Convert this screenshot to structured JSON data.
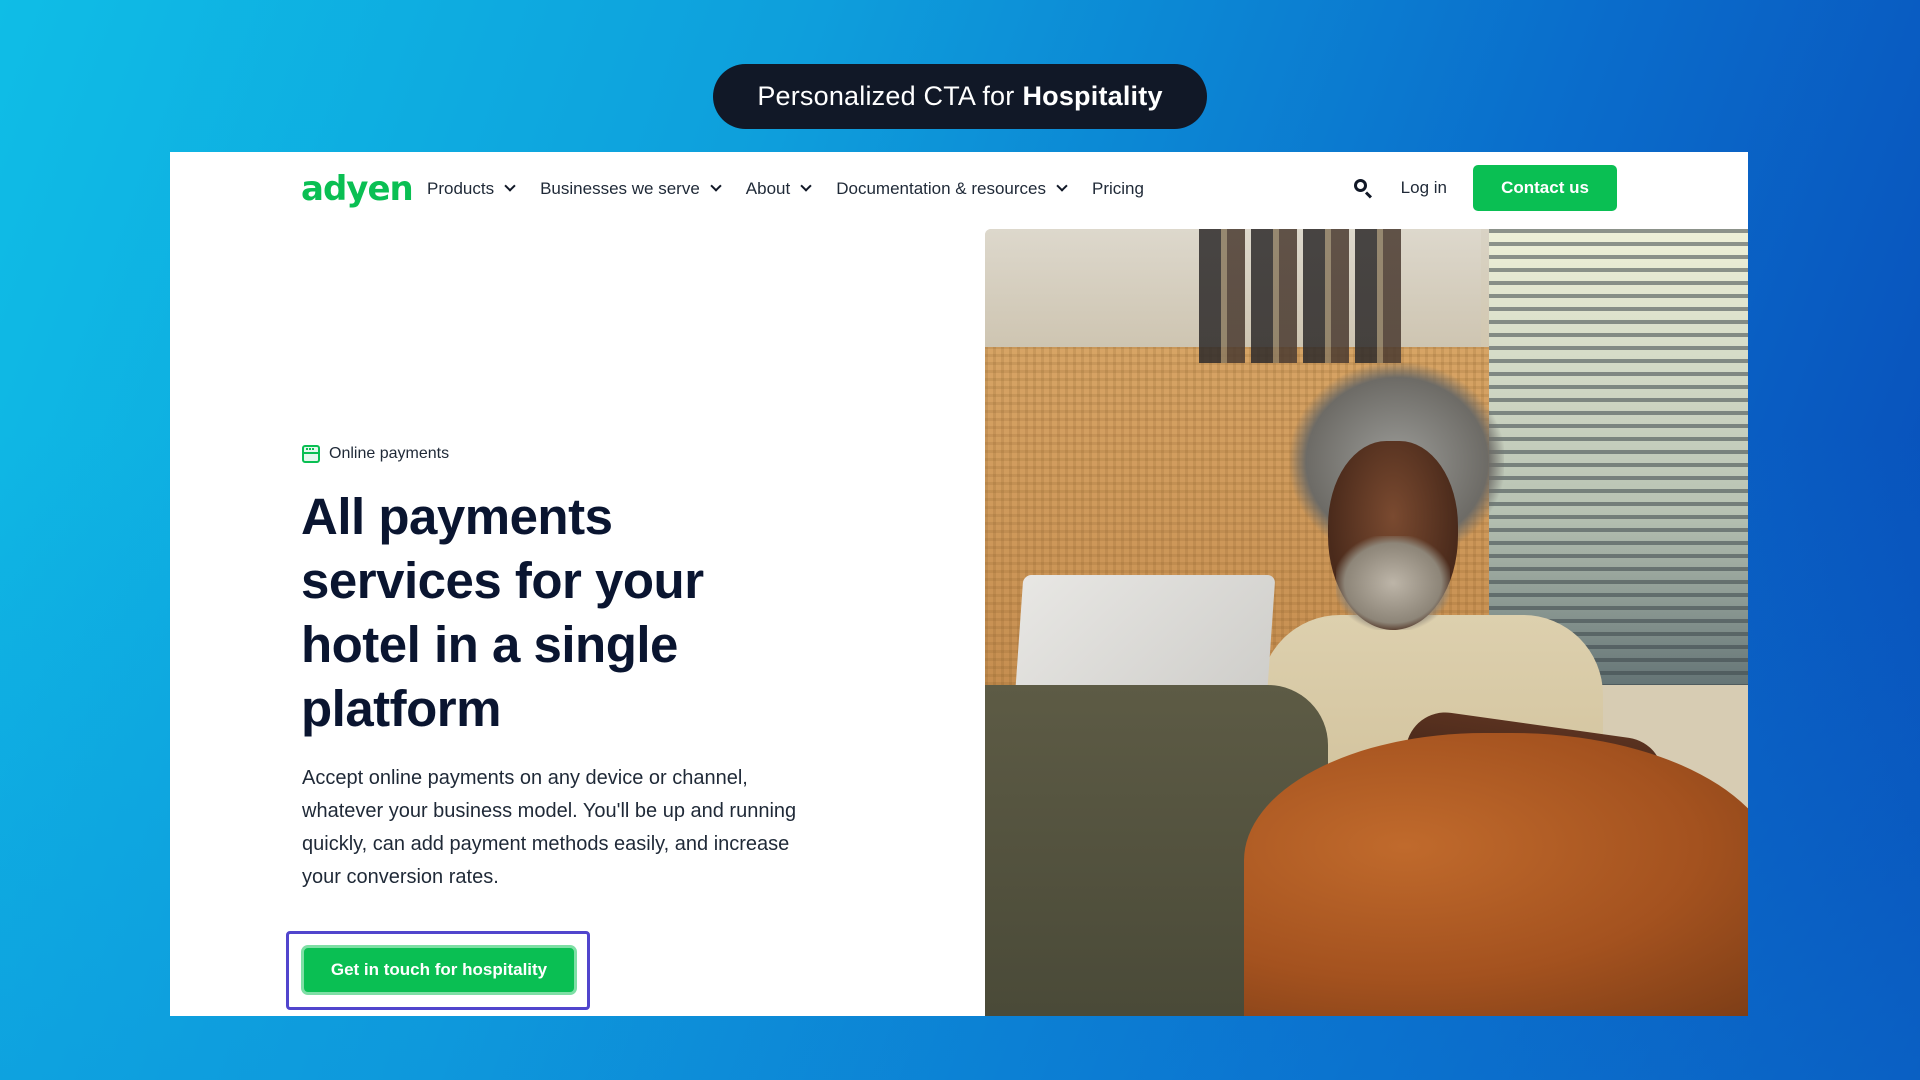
{
  "caption": {
    "prefix": "Personalized CTA for",
    "highlight": "Hospitality"
  },
  "nav": {
    "logo": "adyen",
    "items": [
      {
        "label": "Products",
        "has_dropdown": true
      },
      {
        "label": "Businesses we serve",
        "has_dropdown": true
      },
      {
        "label": "About",
        "has_dropdown": true
      },
      {
        "label": "Documentation & resources",
        "has_dropdown": true
      },
      {
        "label": "Pricing",
        "has_dropdown": false
      }
    ],
    "search_icon": "search-icon",
    "login_label": "Log in",
    "contact_label": "Contact us"
  },
  "hero": {
    "eyebrow_icon": "browser-window-icon",
    "eyebrow": "Online payments",
    "headline": "All payments services for your hotel in a single platform",
    "description": "Accept online payments on any device or channel, whatever your business model. You'll be up and running quickly, can add payment methods easily, and increase your conversion rates.",
    "cta_label": "Get in touch for hospitality",
    "image_alt": "Smiling man with grey curly hair using a laptop on a sofa while petting a brown dog"
  },
  "colors": {
    "brand_green": "#0abf53",
    "highlight_outline": "#5145cd",
    "caption_bg": "#111827",
    "text_dark": "#0a1530"
  }
}
